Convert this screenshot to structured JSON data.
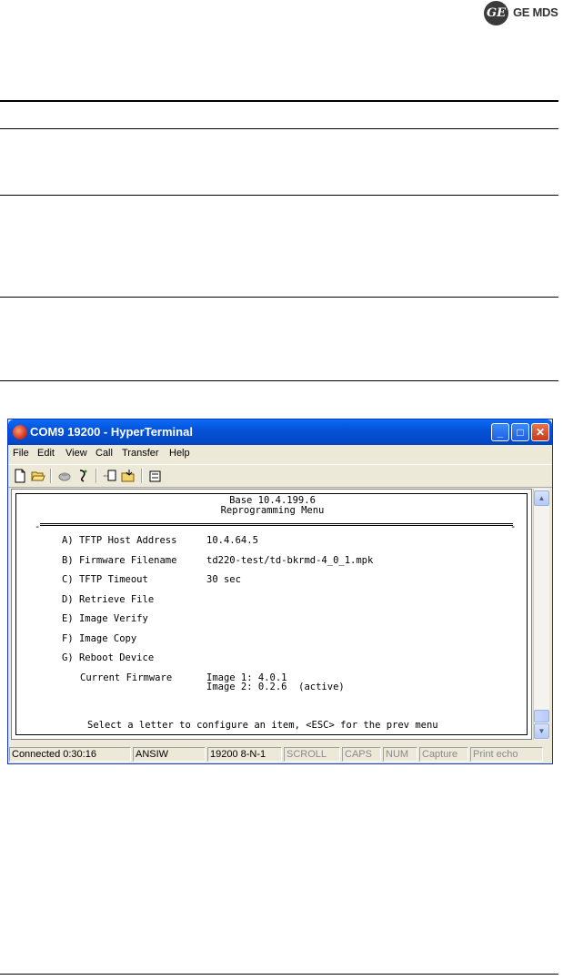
{
  "logo": {
    "emblem": "GE",
    "text": "GE MDS"
  },
  "window": {
    "title": "COM9 19200 - HyperTerminal",
    "controls": {
      "minimize": "_",
      "maximize": "□",
      "close": "✕"
    }
  },
  "menu": [
    "File",
    "Edit",
    "View",
    "Call",
    "Transfer",
    "Help"
  ],
  "toolbar_icons": [
    "new-icon",
    "open-icon",
    "disconnect-icon",
    "dial-icon",
    "send-icon",
    "receive-icon",
    "properties-icon"
  ],
  "terminal": {
    "header_line1": "Base 10.4.199.6",
    "header_line2": "Reprogramming Menu",
    "items": [
      {
        "key": "A) TFTP Host Address",
        "value": "10.4.64.5"
      },
      {
        "key": "B) Firmware Filename",
        "value": "td220-test/td-bkrmd-4_0_1.mpk"
      },
      {
        "key": "C) TFTP Timeout",
        "value": "30 sec"
      },
      {
        "key": "D) Retrieve File",
        "value": ""
      },
      {
        "key": "E) Image Verify",
        "value": ""
      },
      {
        "key": "F) Image Copy",
        "value": ""
      },
      {
        "key": "G) Reboot Device",
        "value": ""
      }
    ],
    "current_firmware_label": "Current Firmware",
    "image1": "Image 1: 4.0.1",
    "image2": "Image 2: 0.2.6  (active)",
    "prompt": "Select a letter to configure an item, <ESC> for the prev menu"
  },
  "status": [
    {
      "label": "Connected 0:30:16",
      "active": true
    },
    {
      "label": "ANSIW",
      "active": true
    },
    {
      "label": "19200 8-N-1",
      "active": true
    },
    {
      "label": "SCROLL",
      "active": false
    },
    {
      "label": "CAPS",
      "active": false
    },
    {
      "label": "NUM",
      "active": false
    },
    {
      "label": "Capture",
      "active": false
    },
    {
      "label": "Print echo",
      "active": false
    }
  ]
}
